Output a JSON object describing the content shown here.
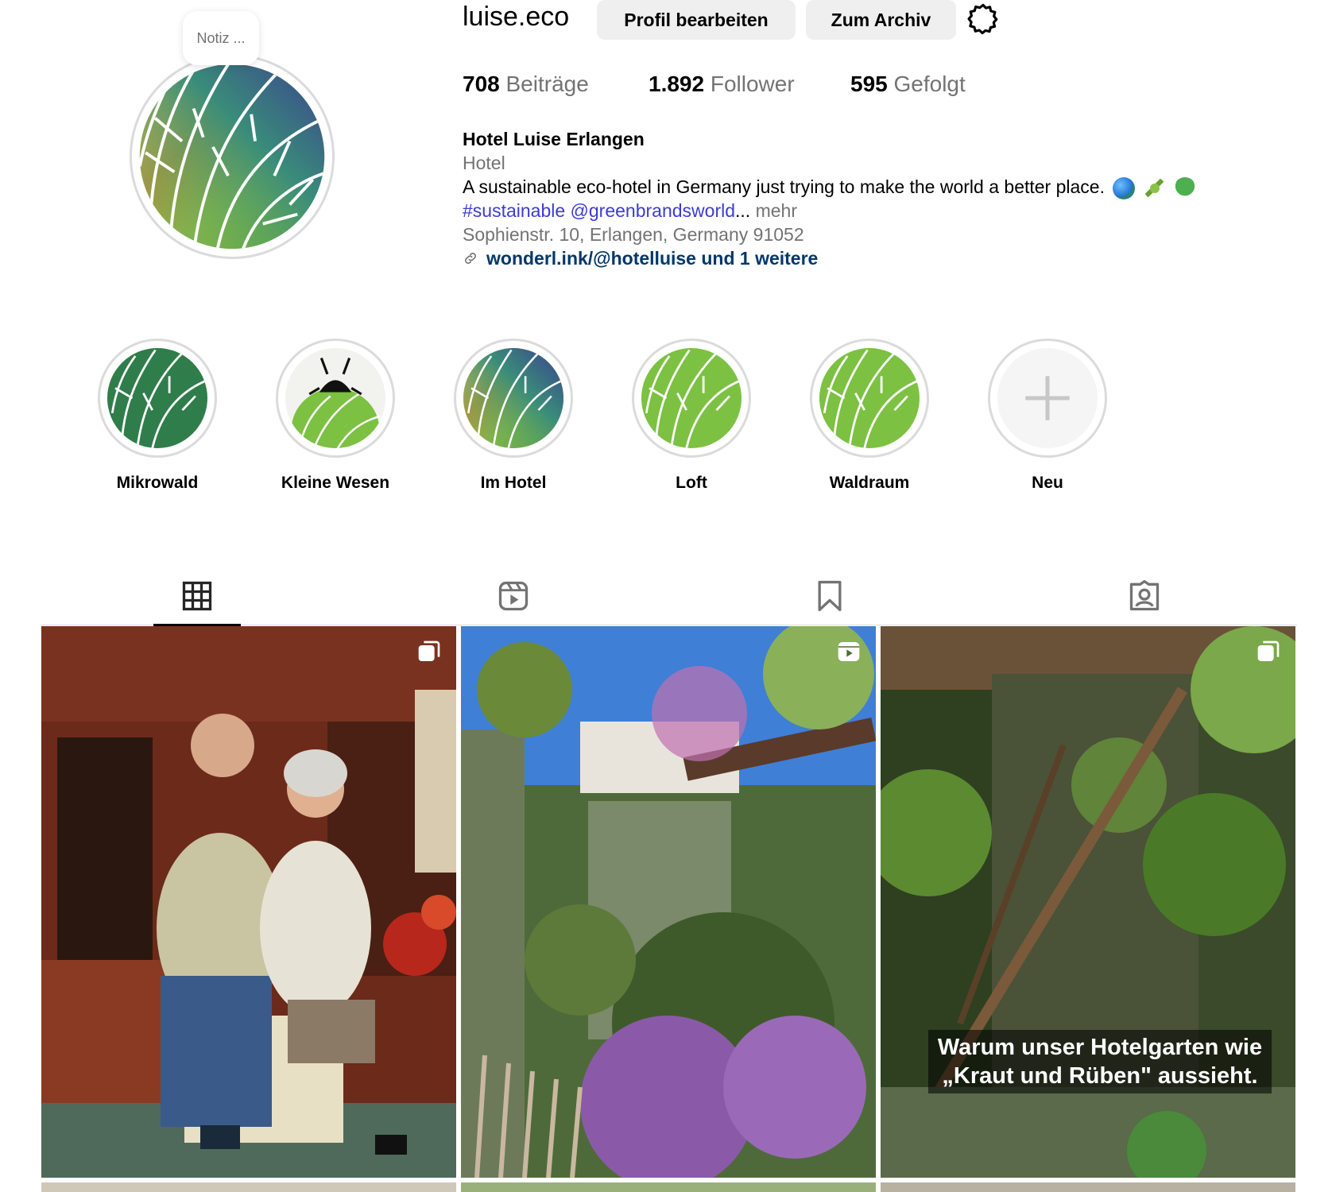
{
  "profile": {
    "username": "luise.eco",
    "note": "Notiz ...",
    "edit_button": "Profil bearbeiten",
    "archive_button": "Zum Archiv"
  },
  "stats": [
    {
      "value": "708",
      "label": "Beiträge"
    },
    {
      "value": "1.892",
      "label": "Follower"
    },
    {
      "value": "595",
      "label": "Gefolgt"
    }
  ],
  "bio": {
    "name": "Hotel Luise Erlangen",
    "category": "Hotel",
    "description": "A sustainable eco-hotel in Germany just trying to make the world a better place.",
    "hashtag": "#sustainable",
    "mention": "@greenbrandsworld",
    "ellipsis": "...",
    "more": "mehr",
    "address": "Sophienstr. 10, Erlangen, Germany 91052",
    "link": "wonderl.ink/@hotelluise und 1 weitere"
  },
  "highlights": [
    {
      "label": "Mikrowald",
      "icon": "dark-green-leaf-icon"
    },
    {
      "label": "Kleine Wesen",
      "icon": "beetle-on-leaf-icon"
    },
    {
      "label": "Im Hotel",
      "icon": "gradient-leaf-icon"
    },
    {
      "label": "Loft",
      "icon": "green-leaf-icon"
    },
    {
      "label": "Waldraum",
      "icon": "green-leaf-icon"
    },
    {
      "label": "Neu",
      "icon": "plus-icon"
    }
  ],
  "tabs": [
    "grid-icon",
    "reels-icon",
    "saved-icon",
    "tagged-icon"
  ],
  "posts": [
    {
      "type": "carousel",
      "icon": "carousel-icon"
    },
    {
      "type": "reel",
      "icon": "reels-icon"
    },
    {
      "type": "carousel",
      "icon": "carousel-icon",
      "caption": "Warum unser Hotelgarten wie „Kraut und Rüben\" aussieht."
    }
  ],
  "colors": {
    "link": "#00376b",
    "hashtag": "#3b3bd6",
    "muted": "#737373",
    "button_bg": "#efefef",
    "brand_green": "#7cb342",
    "dark_green": "#2e7d4a"
  }
}
